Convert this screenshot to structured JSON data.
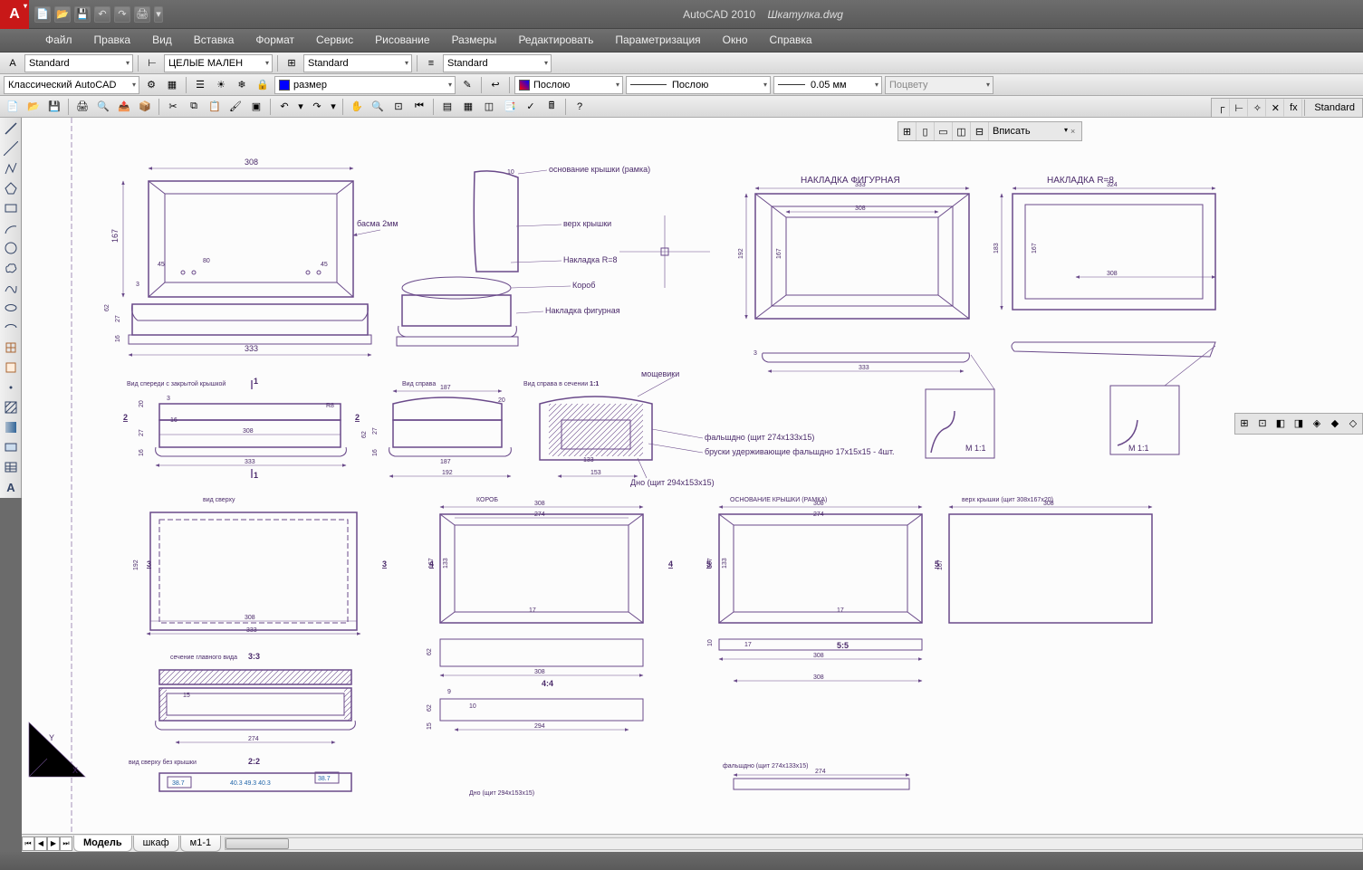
{
  "title": {
    "app": "AutoCAD 2010",
    "file": "Шкатулка.dwg"
  },
  "menu": [
    "Файл",
    "Правка",
    "Вид",
    "Вставка",
    "Формат",
    "Сервис",
    "Рисование",
    "Размеры",
    "Редактировать",
    "Параметризация",
    "Окно",
    "Справка"
  ],
  "row1": {
    "textstyle": "Standard",
    "dimstyle": "ЦЕЛЫЕ МАЛЕН",
    "tablestyle": "Standard",
    "mlstyle": "Standard"
  },
  "row2": {
    "workspace": "Классический AutoCAD",
    "layer": "размер",
    "color": "Послою",
    "ltype": "Послою",
    "lweight": "0.05 мм",
    "plotstyle": "Поцвету"
  },
  "viewport": {
    "fit": "Вписать"
  },
  "right_mini": {
    "label": "Standard"
  },
  "tabs": {
    "items": [
      "Модель",
      "шкаф",
      "м1-1"
    ],
    "active": 0
  },
  "drawing": {
    "titles": {
      "nak_fig": "НАКЛАДКА ФИГУРНАЯ",
      "nak_r8": "НАКЛАДКА R=8",
      "view_front_closed": "Вид спереди с закрытой крышкой",
      "view_right": "Вид справа",
      "view_right_sec": "Вид справа в сечении",
      "scale11a": "1:1",
      "scale11b": "M 1:1",
      "scale11c": "M 1:1",
      "view_top": "вид сверху",
      "korob": "КОРОБ",
      "osn": "ОСНОВАНИЕ КРЫШКИ (РАМКА)",
      "verh_kr": "верх крышки (щит 308х167х20)",
      "sech_main": "сечение главного вида",
      "scale33": "3:3",
      "scale22": "2:2",
      "scale44": "4:4",
      "scale55": "5:5",
      "top_no_lid": "вид сверху без крышки",
      "dno_label": "Дно (щит 294х153х15)",
      "falsh_label": "фальшдно (щит 274х133х15)"
    },
    "leaders": {
      "l1": "основание крышки (рамка)",
      "l2": "верх крышки",
      "l3": "Накладка R=8",
      "l4": "Короб",
      "l5": "Накладка фигурная",
      "l6": "мощевики",
      "l7": "фальшдно (щит 274х133х15)",
      "l8": "бруски удерживающие фальшдно 17х15х15 - 4шт.",
      "l9": "Дно (щит 294х153х15)",
      "basma": "басма 2мм"
    },
    "dims": {
      "d308": "308",
      "d333": "333",
      "d167": "167",
      "d192": "192",
      "d274": "274",
      "d294": "294",
      "d153": "153",
      "d133": "133",
      "d324": "324",
      "d183": "183",
      "d62": "62",
      "d27": "27",
      "d16": "16",
      "d3": "3",
      "d20": "20",
      "d10": "10",
      "d17": "17",
      "d80": "80",
      "d45": "45",
      "d187": "187",
      "d9": "9",
      "d15": "15",
      "R8": "R8",
      "d38_7": "38.7",
      "d40_3": "40.3",
      "d49_3": "49.3"
    },
    "marks": {
      "m1": "1",
      "m2": "2",
      "m3": "3",
      "m4": "4",
      "m5": "5"
    }
  }
}
